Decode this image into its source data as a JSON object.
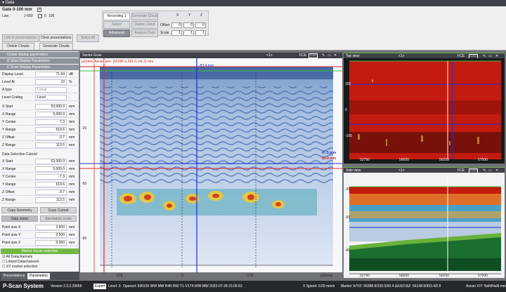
{
  "window": {
    "title": "Data"
  },
  "gate": {
    "title": "Gate 0-100 mm",
    "sub_label": "Law",
    "law_value": "1-650",
    "num_a": "0",
    "num_b": "100"
  },
  "toolbar": {
    "link_presentations": "Link to presentations",
    "clear_presentations": "Clear presentations",
    "select_all": "Select All",
    "delete_clouds": "Delete Clouds",
    "generate_clouds": "Generate Clouds",
    "recording": "Recording 1",
    "generate_cloud": "Generate Cloud",
    "select": "Select",
    "delete_cloud": "Delete Cloud",
    "advanced": "Advanced",
    "analyze_data": "Analyze Data"
  },
  "transform": {
    "headers": [
      "X",
      "Y",
      "Z"
    ],
    "offset_label": "Offset",
    "offset": [
      "0",
      "0",
      "0"
    ],
    "scale_label": "Scale",
    "scale": [
      "1",
      "1",
      "1"
    ]
  },
  "left": {
    "sections": [
      "Global display parameters",
      "B Scan Display Parameters",
      "C Scan Display Parameters"
    ],
    "display_level": {
      "label": "Display Level",
      "value": "71.94",
      "unit": "dB"
    },
    "level_at": {
      "label": "Level At",
      "value": "10",
      "unit": "%"
    },
    "a_type": {
      "label": "A type",
      "value": "Linear"
    },
    "level_coding": {
      "label": "Level Coding",
      "value": "Level"
    },
    "view_rows": [
      {
        "label": "X Start",
        "value": "53,000.0",
        "unit": "mm"
      },
      {
        "label": "X Range",
        "value": "5,000.0",
        "unit": "mm"
      },
      {
        "label": "Y Center",
        "value": "-7.3",
        "unit": "mm"
      },
      {
        "label": "Y Range",
        "value": "619.6",
        "unit": "mm"
      },
      {
        "label": "Z Offset",
        "value": "-3.7",
        "unit": "mm"
      },
      {
        "label": "Z Range",
        "value": "113.5",
        "unit": "mm"
      }
    ],
    "cuboid_title": "Data Selection Cuboid",
    "cuboid_rows": [
      {
        "label": "X Start",
        "value": "53,000.0",
        "unit": "mm"
      },
      {
        "label": "X Range",
        "value": "5,000.0",
        "unit": "mm"
      },
      {
        "label": "Y Center",
        "value": "-7.3",
        "unit": "mm"
      },
      {
        "label": "Y Range",
        "value": "619.6",
        "unit": "mm"
      },
      {
        "label": "Z Offset",
        "value": "-3.7",
        "unit": "mm"
      },
      {
        "label": "Z Range",
        "value": "113.5",
        "unit": "mm"
      }
    ],
    "copy_geometry": "Copy Geometry",
    "copy_cuboid": "Copy Cuboid",
    "data_zoom": "Data zoom",
    "annotation_zoom": "Annotation zoom",
    "point_rows": [
      {
        "label": "Point size X",
        "value": "2.500",
        "unit": "mm"
      },
      {
        "label": "Point size Y",
        "value": "0.500",
        "unit": "mm"
      },
      {
        "label": "Point size Z",
        "value": "0.050",
        "unit": "mm"
      }
    ],
    "marker_title": "Marker Ascan selection",
    "checks": [
      "All Datachannels",
      "Linked Datachannels",
      "XY marker selection"
    ],
    "tabs": [
      "Presentations",
      "Parameters"
    ]
  },
  "sector": {
    "title": "Sector-Scan",
    "center": "<1>",
    "fce": "FCE",
    "ascan_label": "p2(mm)   Ascan pos: (56286.0,281.0,-64.2) mm",
    "top_readout": "-83.4 mm",
    "readout_a": "47.5 mm",
    "readout_b": "50.4 mm",
    "y_ticks": [
      "-20",
      "-50",
      "-80"
    ],
    "x_ticks": [
      "179",
      "0",
      "-179"
    ],
    "x_unit": "p2(mm)"
  },
  "top_view": {
    "title": "Top view",
    "center": "<1>",
    "fce": "FCE",
    "y_ticks": [
      "155",
      "0",
      "-155"
    ],
    "x_ticks": [
      "52750",
      "56000",
      "56250",
      "57500"
    ]
  },
  "side_view": {
    "title": "Side view",
    "center": "<1>",
    "fce": "FCE",
    "y_ticks": [
      "-30",
      "-50",
      "-80"
    ],
    "x_ticks": [
      "52750",
      "56000",
      "56250",
      "57500"
    ]
  },
  "status": {
    "brand": "P-Scan System",
    "version": "Version 2.3.2.29656",
    "level_badge": "Expert",
    "level": "Level: 3",
    "opened": "Opened: 630105 WW MW R48-R60 T1-V174-WW-MW 2023-07-28 23.06.53",
    "speed": "X Speed: 0.00 mm/s",
    "marker": "Marker X/Y/Z: 56388.9/220.0/50.4  ΔX/ΔY/ΔZ: 56138.9/303.4/2.9",
    "ascan": "Ascan X/Y: NaN/NaN mm"
  },
  "colors": {
    "green": "#71b843",
    "bscan_bg": "#c8d8ee",
    "cscan_red": "#c41b10",
    "marker_red": "#e8261f",
    "marker_blue": "#1c2fd0"
  }
}
